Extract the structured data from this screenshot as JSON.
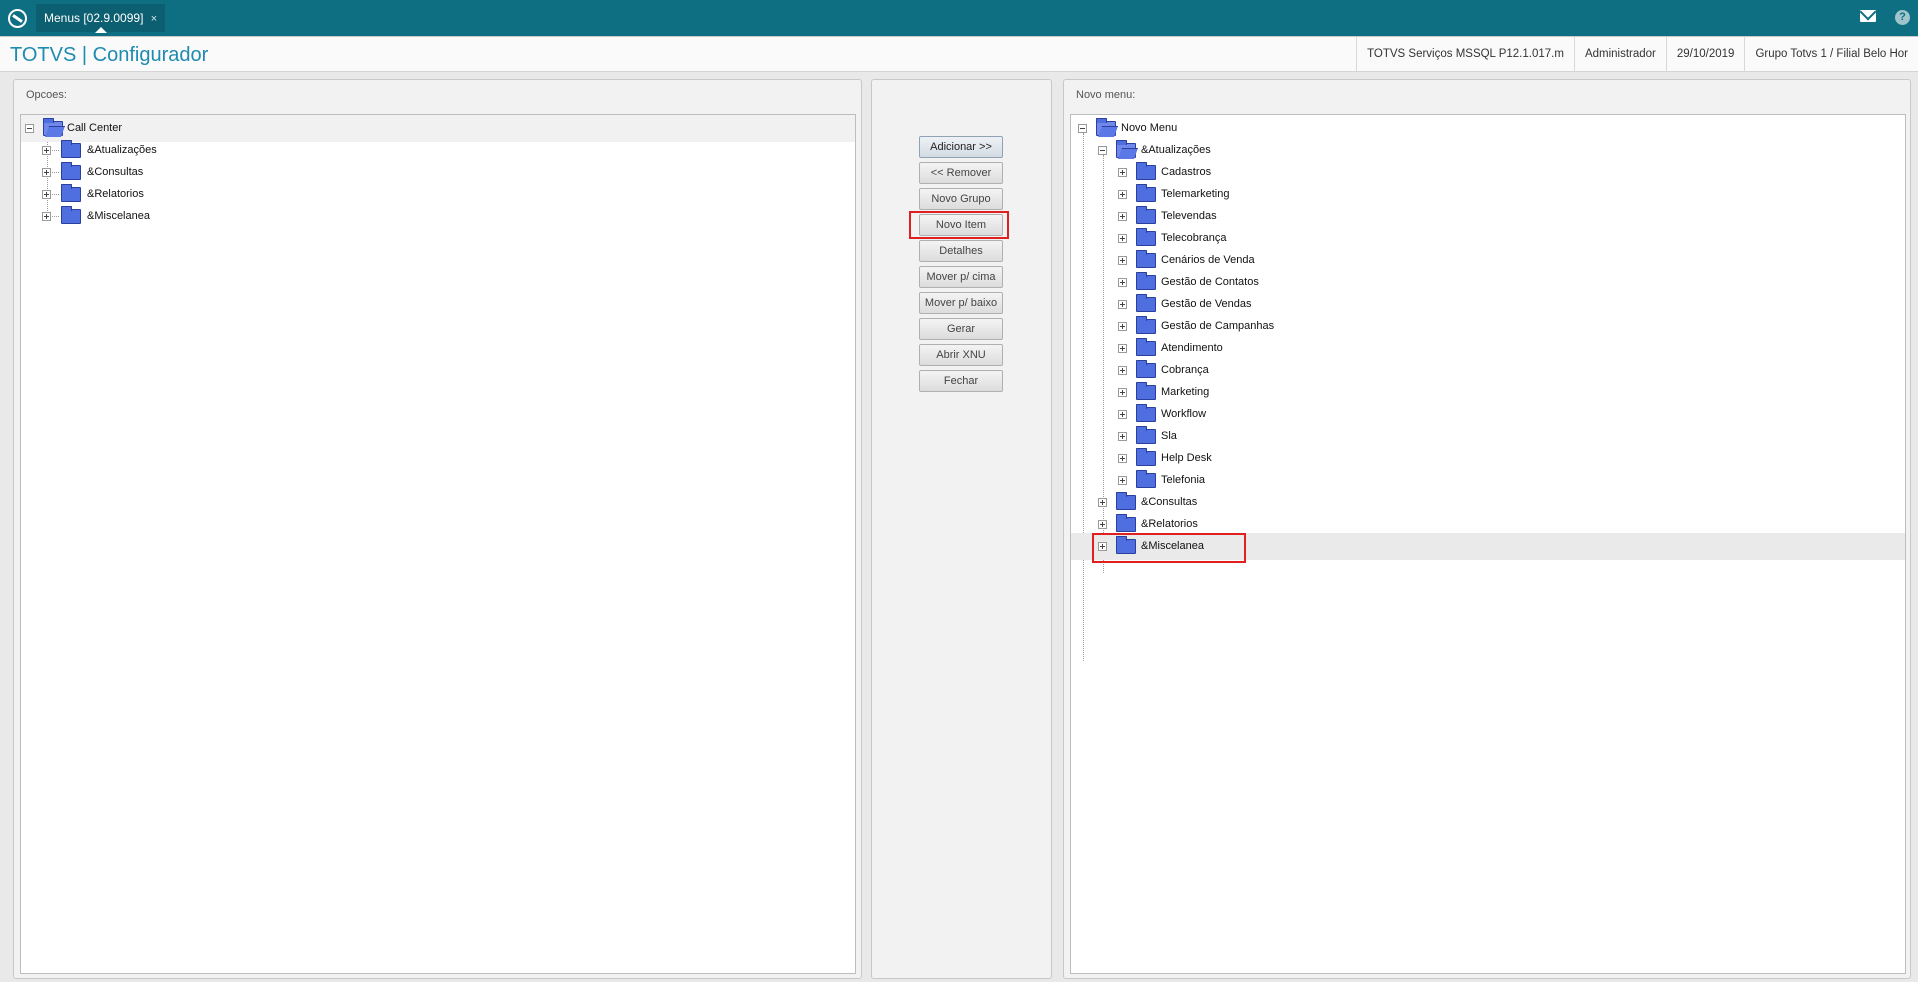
{
  "topbar": {
    "tab_label": "Menus [02.9.0099]",
    "tab_close": "×",
    "mail_icon": "mail-icon",
    "help_label": "?"
  },
  "header": {
    "brand_left": "TOTVS",
    "brand_sep": "|",
    "brand_right": "Configurador",
    "info": [
      "TOTVS Serviços MSSQL P12.1.017.m",
      "Administrador",
      "29/10/2019",
      "Grupo Totvs 1 / Filial Belo Hor"
    ]
  },
  "opcoes": {
    "title": "Opcoes:",
    "root": "Call Center",
    "children": [
      "&Atualizações",
      "&Consultas",
      "&Relatorios",
      "&Miscelanea"
    ]
  },
  "buttons": {
    "adicionar": "Adicionar >>",
    "remover": "<< Remover",
    "novo_grupo": "Novo Grupo",
    "novo_item": "Novo Item",
    "detalhes": "Detalhes",
    "mover_cima": "Mover p/ cima",
    "mover_baixo": "Mover p/ baixo",
    "gerar": "Gerar",
    "abrir_xnu": "Abrir XNU",
    "fechar": "Fechar"
  },
  "novo_menu": {
    "title": "Novo menu:",
    "root": "Novo Menu",
    "atualizacoes": "&Atualizações",
    "atualizacoes_children": [
      "Cadastros",
      "Telemarketing",
      "Televendas",
      "Telecobrança",
      "Cenários de Venda",
      "Gestão de Contatos",
      "Gestão de Vendas",
      "Gestão de Campanhas",
      "Atendimento",
      "Cobrança",
      "Marketing",
      "Workflow",
      "Sla",
      "Help Desk",
      "Telefonia"
    ],
    "consultas": "&Consultas",
    "relatorios": "&Relatorios",
    "miscelanea": "&Miscelanea",
    "selected": "&Miscelanea"
  },
  "colors": {
    "topbar": "#0f6f82",
    "brand": "#1e8bb0",
    "folder": "#4f6ee0",
    "highlight": "#e02020"
  }
}
